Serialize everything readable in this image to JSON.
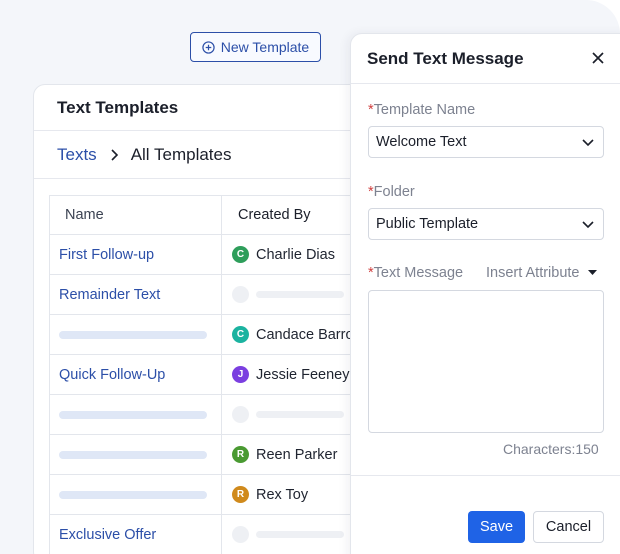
{
  "toolbar": {
    "new_template_label": "New Template"
  },
  "templates_card": {
    "title": "Text Templates",
    "breadcrumb": {
      "root": "Texts",
      "current": "All Templates"
    },
    "columns": {
      "name": "Name",
      "created_by": "Created By"
    },
    "rows": [
      {
        "name": "First Follow-up",
        "creator": "Charlie Dias",
        "initial": "C",
        "color": "#2e9e5b"
      },
      {
        "name": "Remainder Text",
        "creator": null
      },
      {
        "name": null,
        "creator": "Candace Barrow",
        "initial": "C",
        "color": "#1bb3a0"
      },
      {
        "name": "Quick Follow-Up",
        "creator": "Jessie Feeney",
        "initial": "J",
        "color": "#7b3fe0"
      },
      {
        "name": null,
        "creator": null
      },
      {
        "name": null,
        "creator": "Reen Parker",
        "initial": "R",
        "color": "#4a9a32"
      },
      {
        "name": null,
        "creator": "Rex Toy",
        "initial": "R",
        "color": "#d08a1c"
      },
      {
        "name": "Exclusive Offer",
        "creator": null
      }
    ]
  },
  "panel": {
    "title": "Send Text Message",
    "template_name": {
      "label": "Template Name",
      "required_mark": "*",
      "value": "Welcome Text"
    },
    "folder": {
      "label": "Folder",
      "required_mark": "*",
      "value": "Public Template"
    },
    "text_message": {
      "label": "Text Message",
      "required_mark": "*",
      "insert_label": "Insert Attribute",
      "value": ""
    },
    "char_count": "Characters:150",
    "save_label": "Save",
    "cancel_label": "Cancel"
  },
  "colors": {
    "accent": "#2c4fa8",
    "primary_button": "#1f63e6",
    "required": "#d04040"
  }
}
